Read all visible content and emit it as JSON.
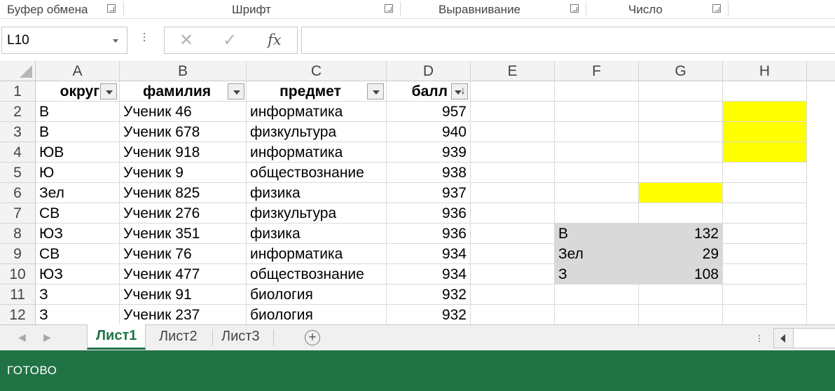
{
  "ribbon": {
    "groups": [
      "Буфер обмена",
      "Шрифт",
      "Выравнивание",
      "Число"
    ]
  },
  "formula_bar": {
    "name_box": "L10",
    "cancel_icon": "✕",
    "enter_icon": "✓",
    "fx_label": "fx",
    "formula": ""
  },
  "columns": [
    "A",
    "B",
    "C",
    "D",
    "E",
    "F",
    "G",
    "H"
  ],
  "rows": [
    "1",
    "2",
    "3",
    "4",
    "5",
    "6",
    "7",
    "8",
    "9",
    "10",
    "11",
    "12"
  ],
  "table": {
    "headers": [
      "округ",
      "фамилия",
      "предмет",
      "балл"
    ],
    "data": [
      [
        "В",
        "Ученик 46",
        "информатика",
        "957"
      ],
      [
        "В",
        "Ученик 678",
        "физкультура",
        "940"
      ],
      [
        "ЮВ",
        "Ученик 918",
        "информатика",
        "939"
      ],
      [
        "Ю",
        "Ученик 9",
        "обществознание",
        "938"
      ],
      [
        "Зел",
        "Ученик 825",
        "физика",
        "937"
      ],
      [
        "СВ",
        "Ученик 276",
        "физкультура",
        "936"
      ],
      [
        "ЮЗ",
        "Ученик 351",
        "физика",
        "936"
      ],
      [
        "СВ",
        "Ученик 76",
        "информатика",
        "934"
      ],
      [
        "ЮЗ",
        "Ученик 477",
        "обществознание",
        "934"
      ],
      [
        "З",
        "Ученик 91",
        "биология",
        "932"
      ],
      [
        "З",
        "Ученик 237",
        "биология",
        "932"
      ]
    ]
  },
  "summary": [
    [
      "В",
      "132"
    ],
    [
      "Зел",
      "29"
    ],
    [
      "З",
      "108"
    ]
  ],
  "sort_arrow": "↓",
  "sheet_tabs": [
    "Лист1",
    "Лист2",
    "Лист3"
  ],
  "active_sheet": "Лист1",
  "add_sheet_icon": "+",
  "status": "ГОТОВО",
  "colors": {
    "accent": "#217346",
    "highlight_yellow": "#ffff00",
    "summary_gray": "#d9d9d9"
  }
}
